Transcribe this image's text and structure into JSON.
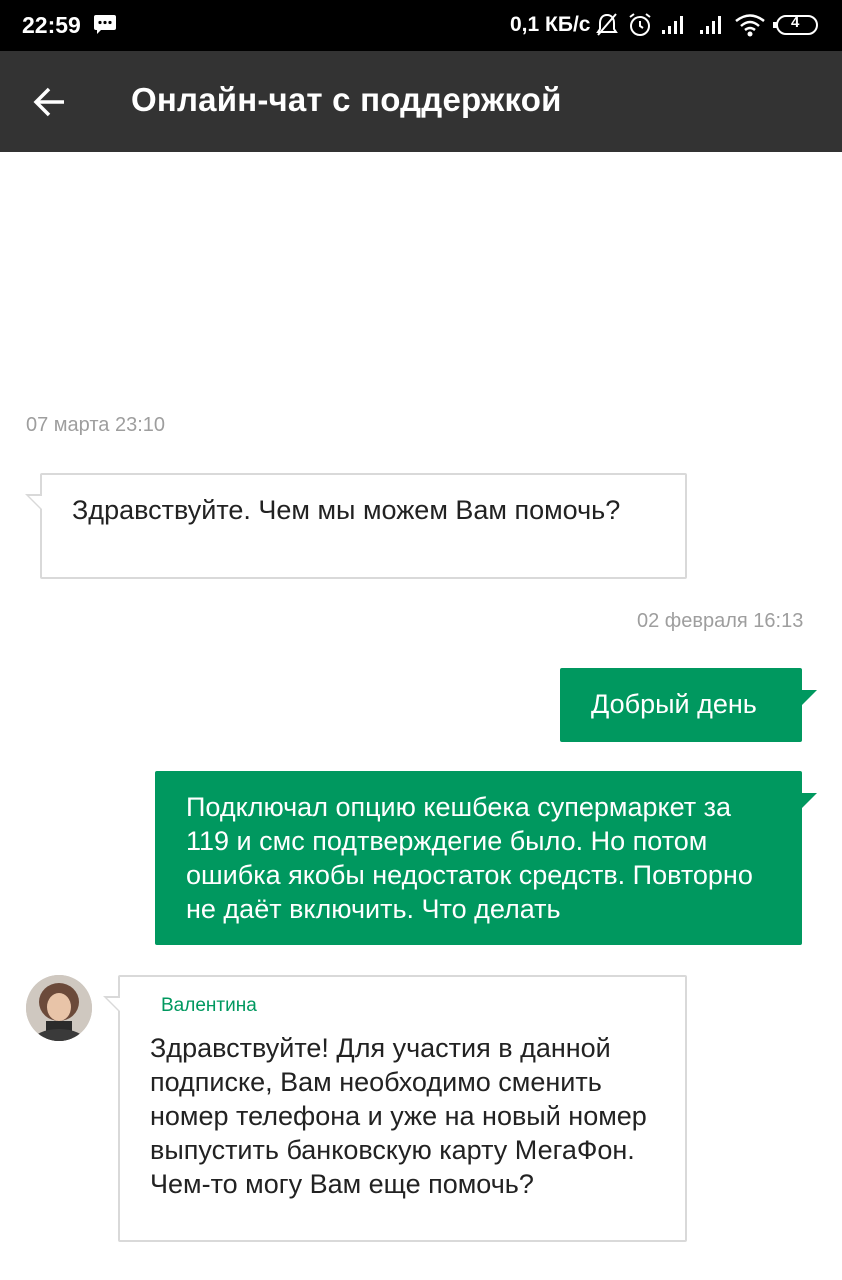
{
  "status_bar": {
    "time": "22:59",
    "speed": "0,1 КБ/с",
    "battery": "4"
  },
  "header": {
    "title": "Онлайн-чат с поддержкой"
  },
  "messages": [
    {
      "timestamp": "07 марта 23:10",
      "direction": "incoming",
      "text": "Здравствуйте. Чем мы можем Вам помочь?"
    },
    {
      "timestamp": "02 февраля 16:13",
      "direction": "outgoing",
      "text": "Добрый день"
    },
    {
      "direction": "outgoing",
      "text": "Подключал опцию кешбека супермаркет за 119 и смс подтверждегие было. Но потом ошибка якобы недостаток средств. Повторно не даёт включить. Что делать"
    },
    {
      "direction": "incoming",
      "sender": "Валентина",
      "text": "Здравствуйте! Для участия в данной подписке, Вам необходимо сменить номер телефона и уже на новый номер выпустить банковскую карту МегаФон. Чем-то могу Вам еще помочь?"
    }
  ],
  "colors": {
    "accent": "#00985f",
    "appbar": "#333333",
    "statusbar": "#000000"
  }
}
